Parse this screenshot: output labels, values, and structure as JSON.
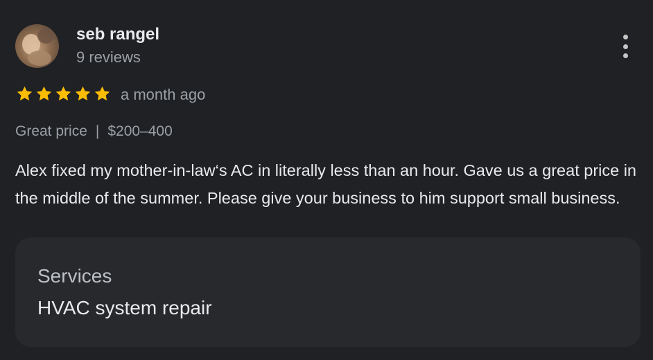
{
  "reviewer": {
    "name": "seb rangel",
    "review_count": "9 reviews",
    "avatar_icon": "user-photo-avatar"
  },
  "menu": {
    "icon": "more-vert-icon"
  },
  "rating": {
    "stars": 5,
    "max_stars": 5,
    "star_color": "#fbbc04",
    "time_ago": "a month ago"
  },
  "meta": {
    "price_label": "Great price",
    "separator": "|",
    "price_range": "$200–400"
  },
  "review": {
    "text": "Alex fixed my mother-in-law‘s AC in literally less than an hour. Gave us a great price in the middle of the summer. Please give your business to him support small business."
  },
  "services": {
    "title": "Services",
    "value": "HVAC system repair"
  },
  "colors": {
    "background": "#202124",
    "panel": "#28292c",
    "primary_text": "#e8eaed",
    "secondary_text": "#9aa0a6"
  }
}
